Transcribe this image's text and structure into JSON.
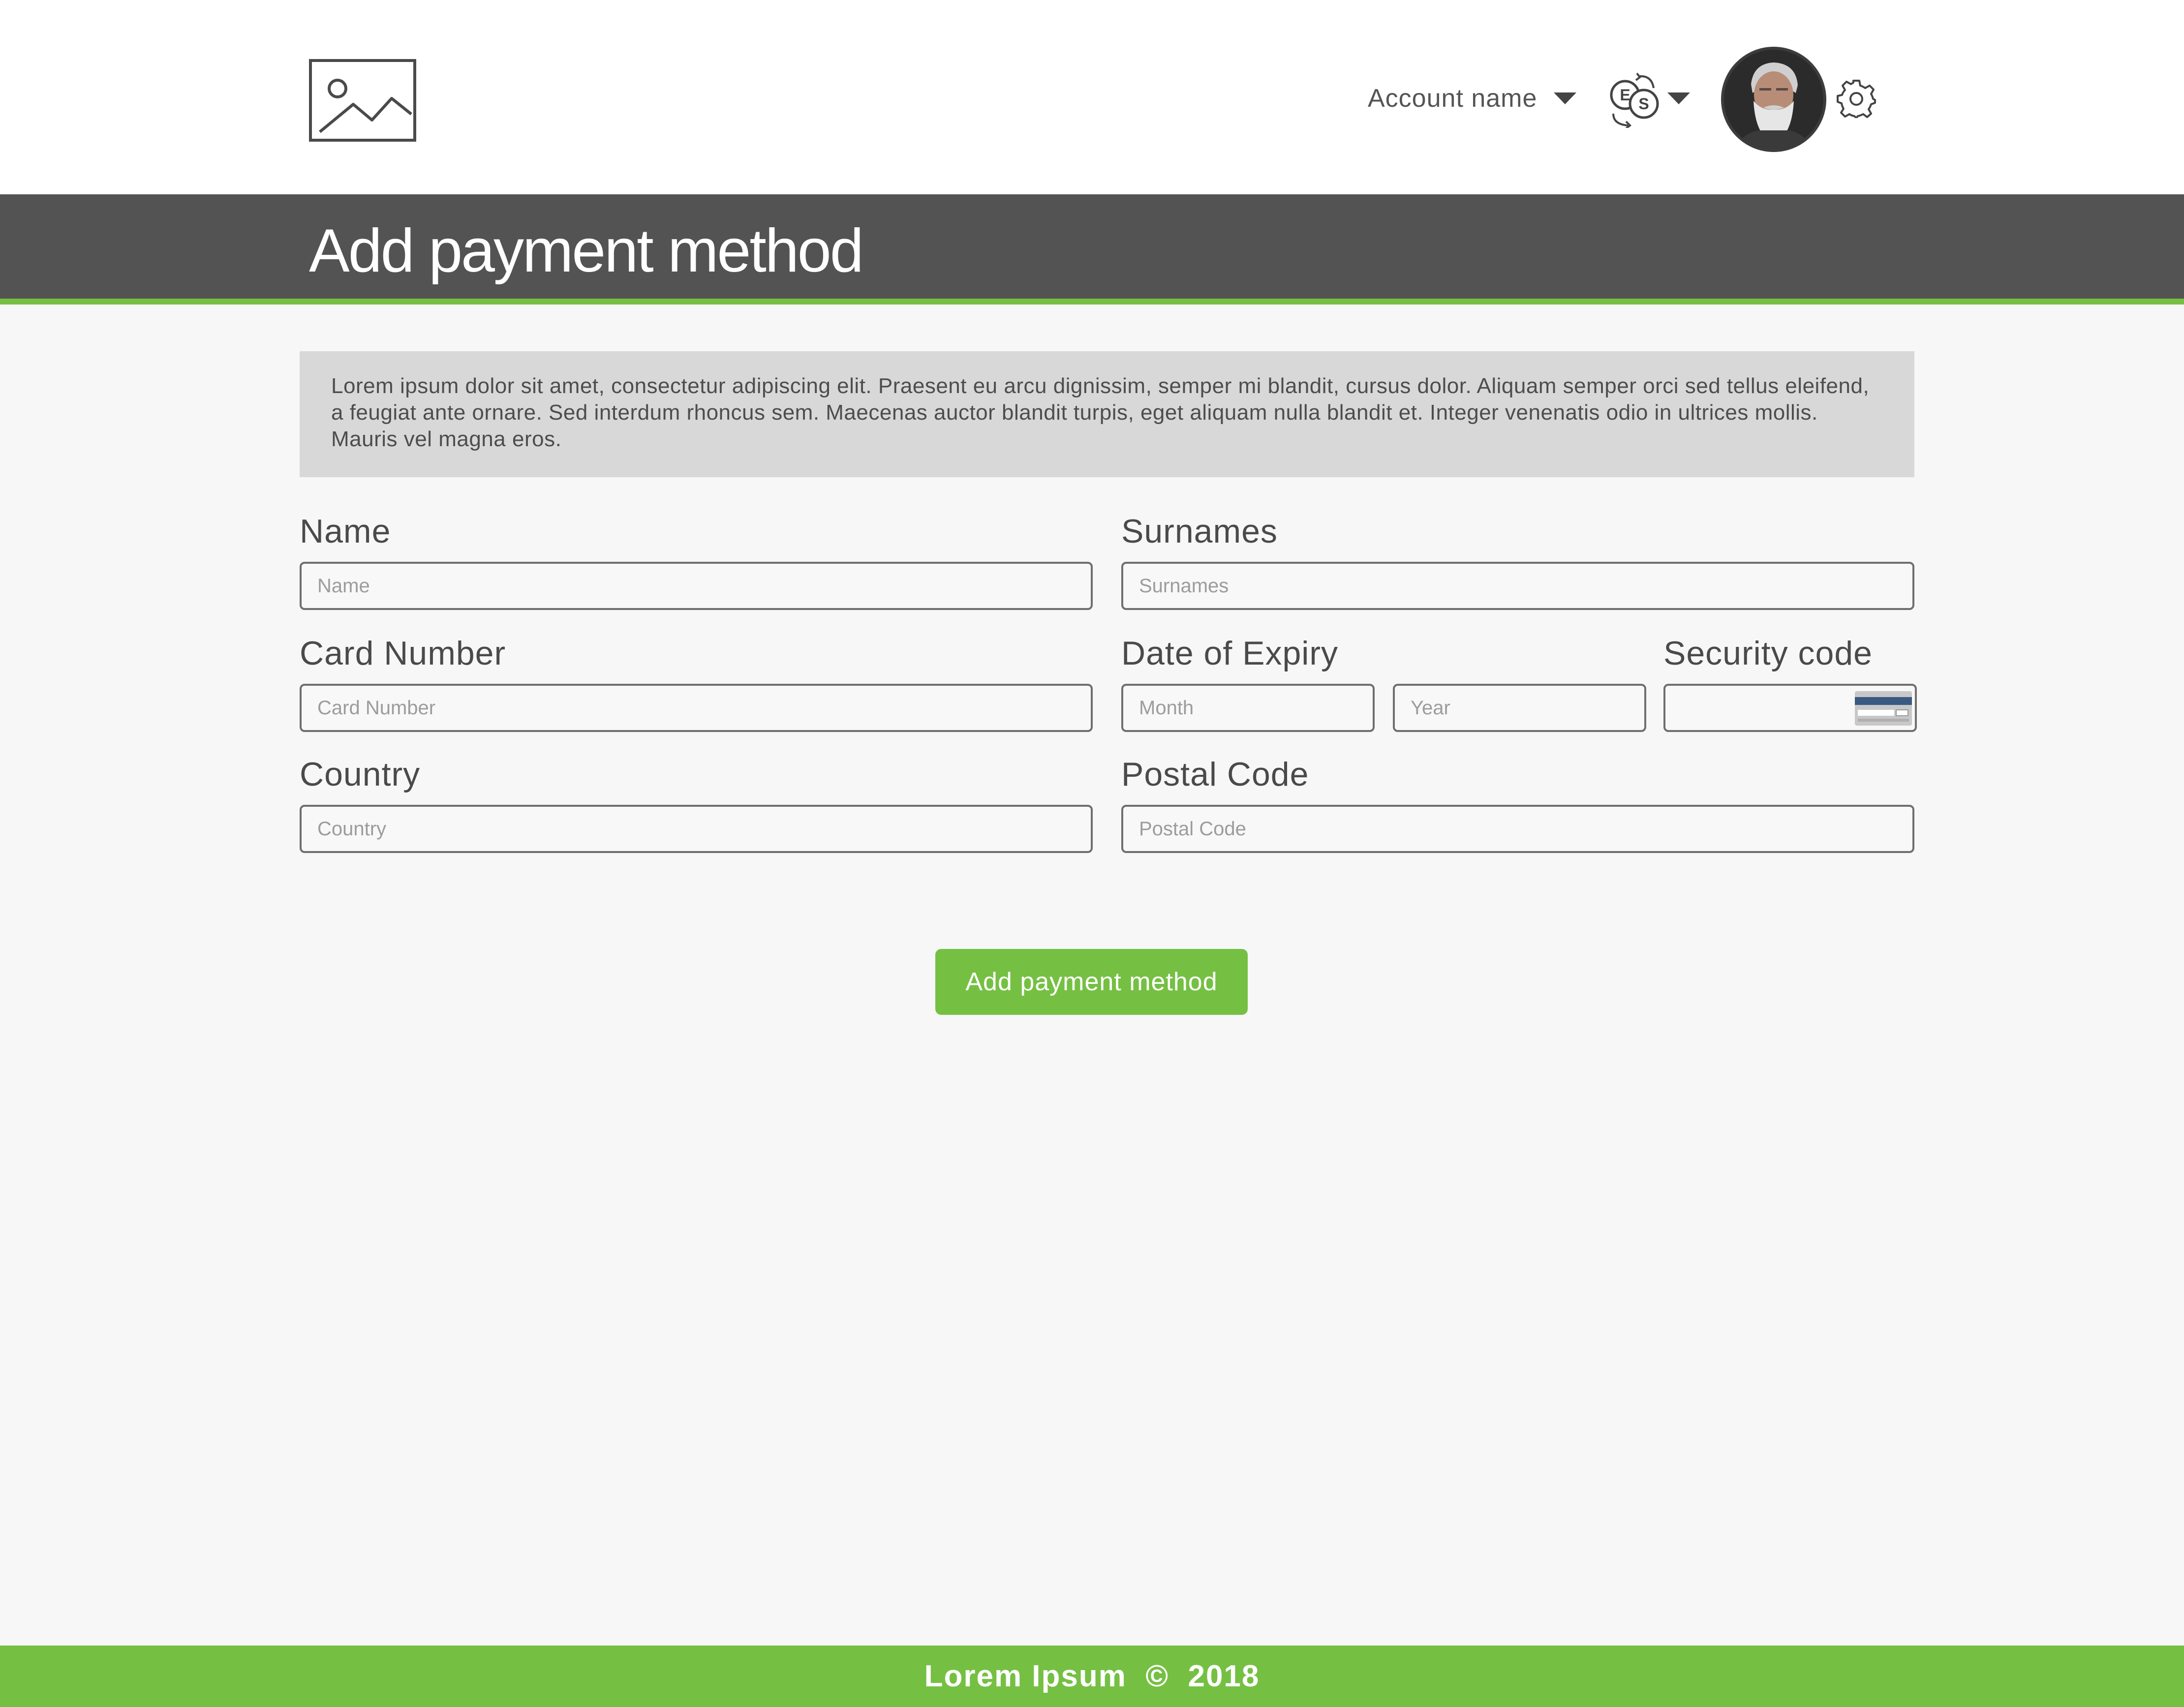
{
  "header": {
    "logo_icon": "image-placeholder-icon",
    "account_name": "Account name",
    "currency_icon": "currency-exchange-icon",
    "currency_symbols": [
      "E",
      "S"
    ],
    "avatar": "user-avatar",
    "settings_icon": "gear-icon"
  },
  "page": {
    "title": "Add payment method",
    "notice": "Lorem ipsum dolor sit amet, consectetur adipiscing elit. Praesent eu arcu dignissim, semper mi blandit, cursus dolor. Aliquam semper orci sed tellus eleifend, a feugiat ante ornare. Sed interdum rhoncus sem. Maecenas auctor blandit turpis, eget aliquam nulla blandit et. Integer venenatis odio in ultrices mollis. Mauris vel magna eros."
  },
  "form": {
    "name": {
      "label": "Name",
      "placeholder": "Name",
      "value": ""
    },
    "surnames": {
      "label": "Surnames",
      "placeholder": "Surnames",
      "value": ""
    },
    "card_number": {
      "label": "Card Number",
      "placeholder": "Card Number",
      "value": ""
    },
    "expiry": {
      "label": "Date of Expiry",
      "month_placeholder": "Month",
      "year_placeholder": "Year"
    },
    "security_code": {
      "label": "Security code",
      "placeholder": "",
      "icon": "card-cvc-icon"
    },
    "country": {
      "label": "Country",
      "placeholder": "Country",
      "value": ""
    },
    "postal_code": {
      "label": "Postal Code",
      "placeholder": "Postal Code",
      "value": ""
    },
    "submit_label": "Add payment method"
  },
  "footer": {
    "text": "Lorem Ipsum  ©  2018"
  },
  "colors": {
    "accent": "#75c043",
    "titlebar": "#535353",
    "notice_bg": "#d8d8d8"
  }
}
